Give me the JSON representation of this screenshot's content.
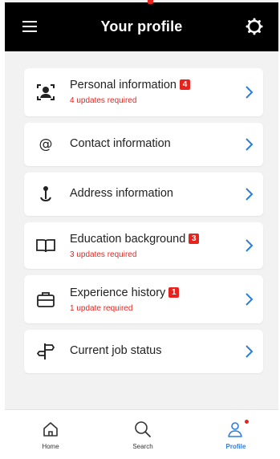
{
  "header": {
    "title": "Your profile"
  },
  "items": [
    {
      "label": "Personal information",
      "badge": "4",
      "sub": "4 updates required"
    },
    {
      "label": "Contact information"
    },
    {
      "label": "Address information"
    },
    {
      "label": "Education background",
      "badge": "3",
      "sub": "3 updates required"
    },
    {
      "label": "Experience history",
      "badge": "1",
      "sub": "1 update required"
    },
    {
      "label": "Current job status"
    }
  ],
  "nav": {
    "home": "Home",
    "search": "Search",
    "profile": "Profile"
  },
  "colors": {
    "accent": "#2a7de1",
    "alert": "#e8231e",
    "header_bg": "#000000",
    "page_bg": "#f2f2f2"
  },
  "icons": [
    "menu-icon",
    "settings-icon",
    "personal-id-icon",
    "at-sign-icon",
    "pin-icon",
    "book-icon",
    "briefcase-icon",
    "signpost-icon",
    "chevron-right-icon",
    "home-icon",
    "search-icon",
    "profile-icon"
  ]
}
